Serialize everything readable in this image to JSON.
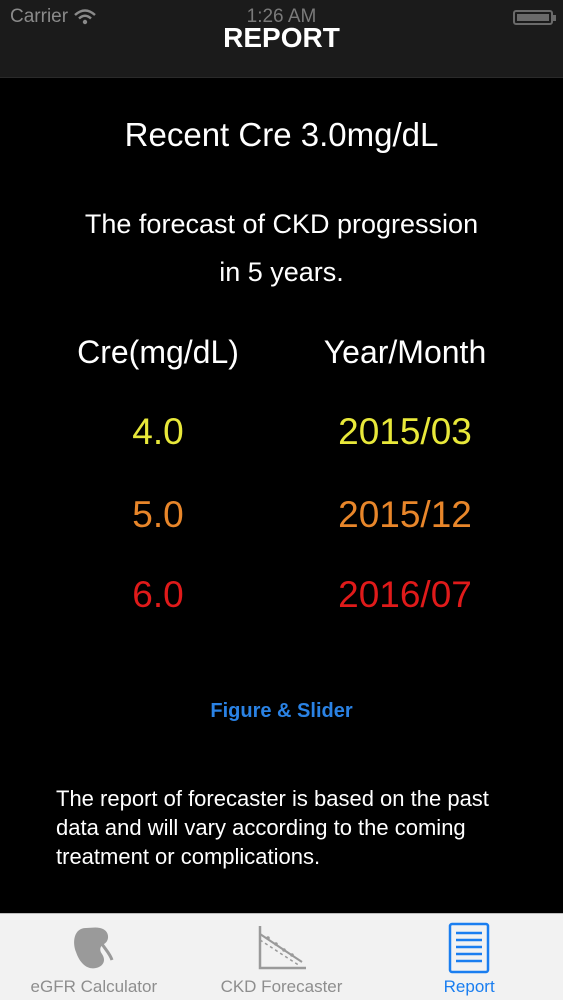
{
  "status_bar": {
    "carrier": "Carrier",
    "time": "1:26 AM"
  },
  "nav": {
    "title": "REPORT"
  },
  "report": {
    "recent": "Recent Cre 3.0mg/dL",
    "forecast_line1": "The forecast of CKD progression",
    "forecast_line2": "in 5 years.",
    "header_cre": "Cre(mg/dL)",
    "header_date": "Year/Month",
    "rows": [
      {
        "cre": "4.0",
        "date": "2015/03",
        "color": "#e8e83a"
      },
      {
        "cre": "5.0",
        "date": "2015/12",
        "color": "#e8862a"
      },
      {
        "cre": "6.0",
        "date": "2016/07",
        "color": "#e01a1a"
      }
    ],
    "link": "Figure & Slider",
    "note": "The report of forecaster is based on the past data and will vary according to the coming treatment or complications."
  },
  "tabs": [
    {
      "label": "eGFR Calculator",
      "icon": "kidney-icon",
      "active": false
    },
    {
      "label": "CKD Forecaster",
      "icon": "graph-icon",
      "active": false
    },
    {
      "label": "Report",
      "icon": "report-list-icon",
      "active": true
    }
  ],
  "colors": {
    "accent": "#1a7ef0",
    "link": "#2a82e4",
    "background": "#000000"
  }
}
